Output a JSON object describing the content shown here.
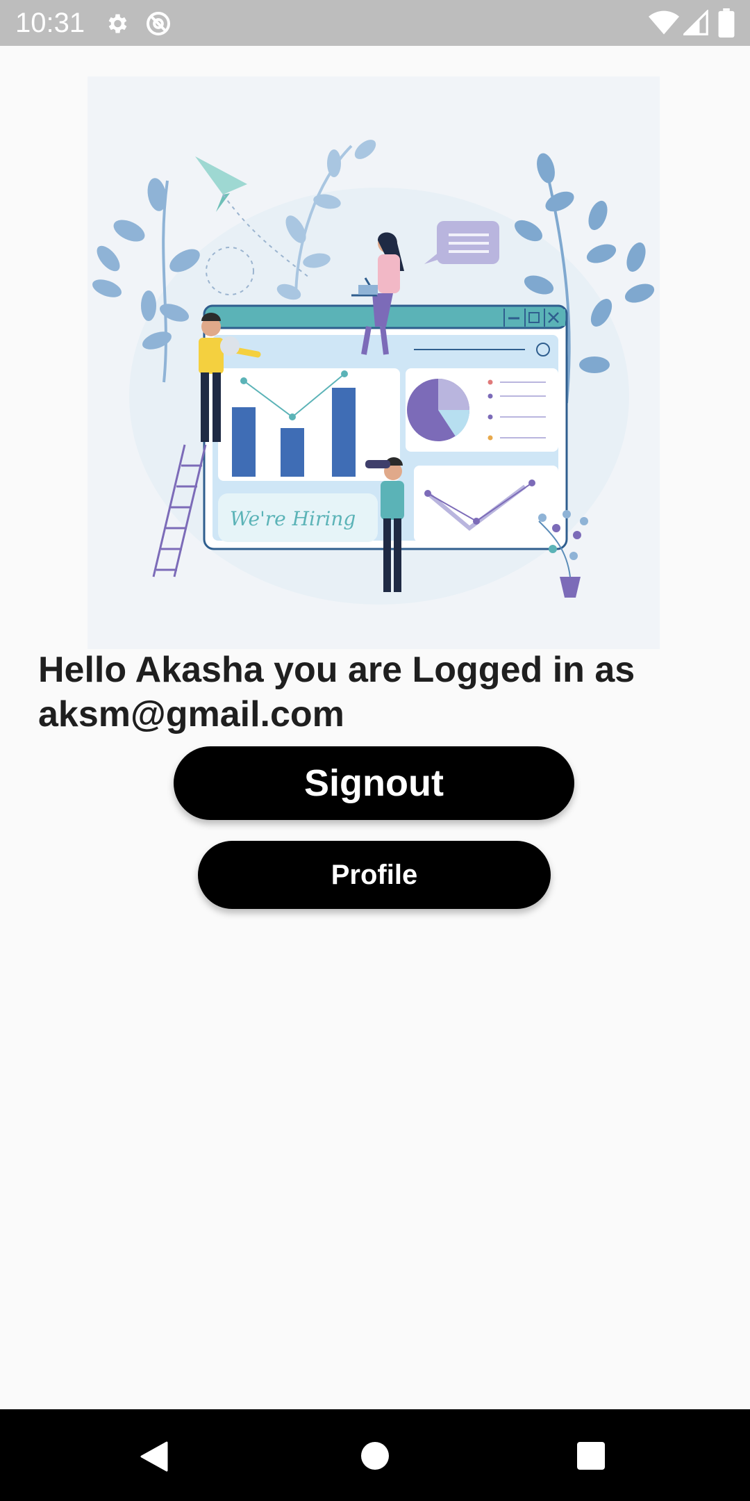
{
  "status_bar": {
    "time": "10:31",
    "icons": [
      "settings-icon",
      "sync-icon",
      "wifi-icon",
      "signal-icon",
      "battery-icon"
    ]
  },
  "hero_image": {
    "icon": "hiring-illustration",
    "banner_text": "We're Hiring"
  },
  "greeting": {
    "text": "Hello Akasha you are Logged in as aksm@gmail.com"
  },
  "buttons": {
    "signout_label": "Signout",
    "profile_label": "Profile"
  },
  "nav_bar": {
    "back": "back-icon",
    "home": "home-icon",
    "recents": "recents-icon"
  },
  "colors": {
    "background": "#FAFAFA",
    "status_bar": "#BDBDBD",
    "button": "#000000",
    "button_text": "#FFFFFF",
    "text": "#1F1F1F",
    "accent_blue": "#3F6DB5",
    "accent_teal": "#5BB3B7"
  }
}
